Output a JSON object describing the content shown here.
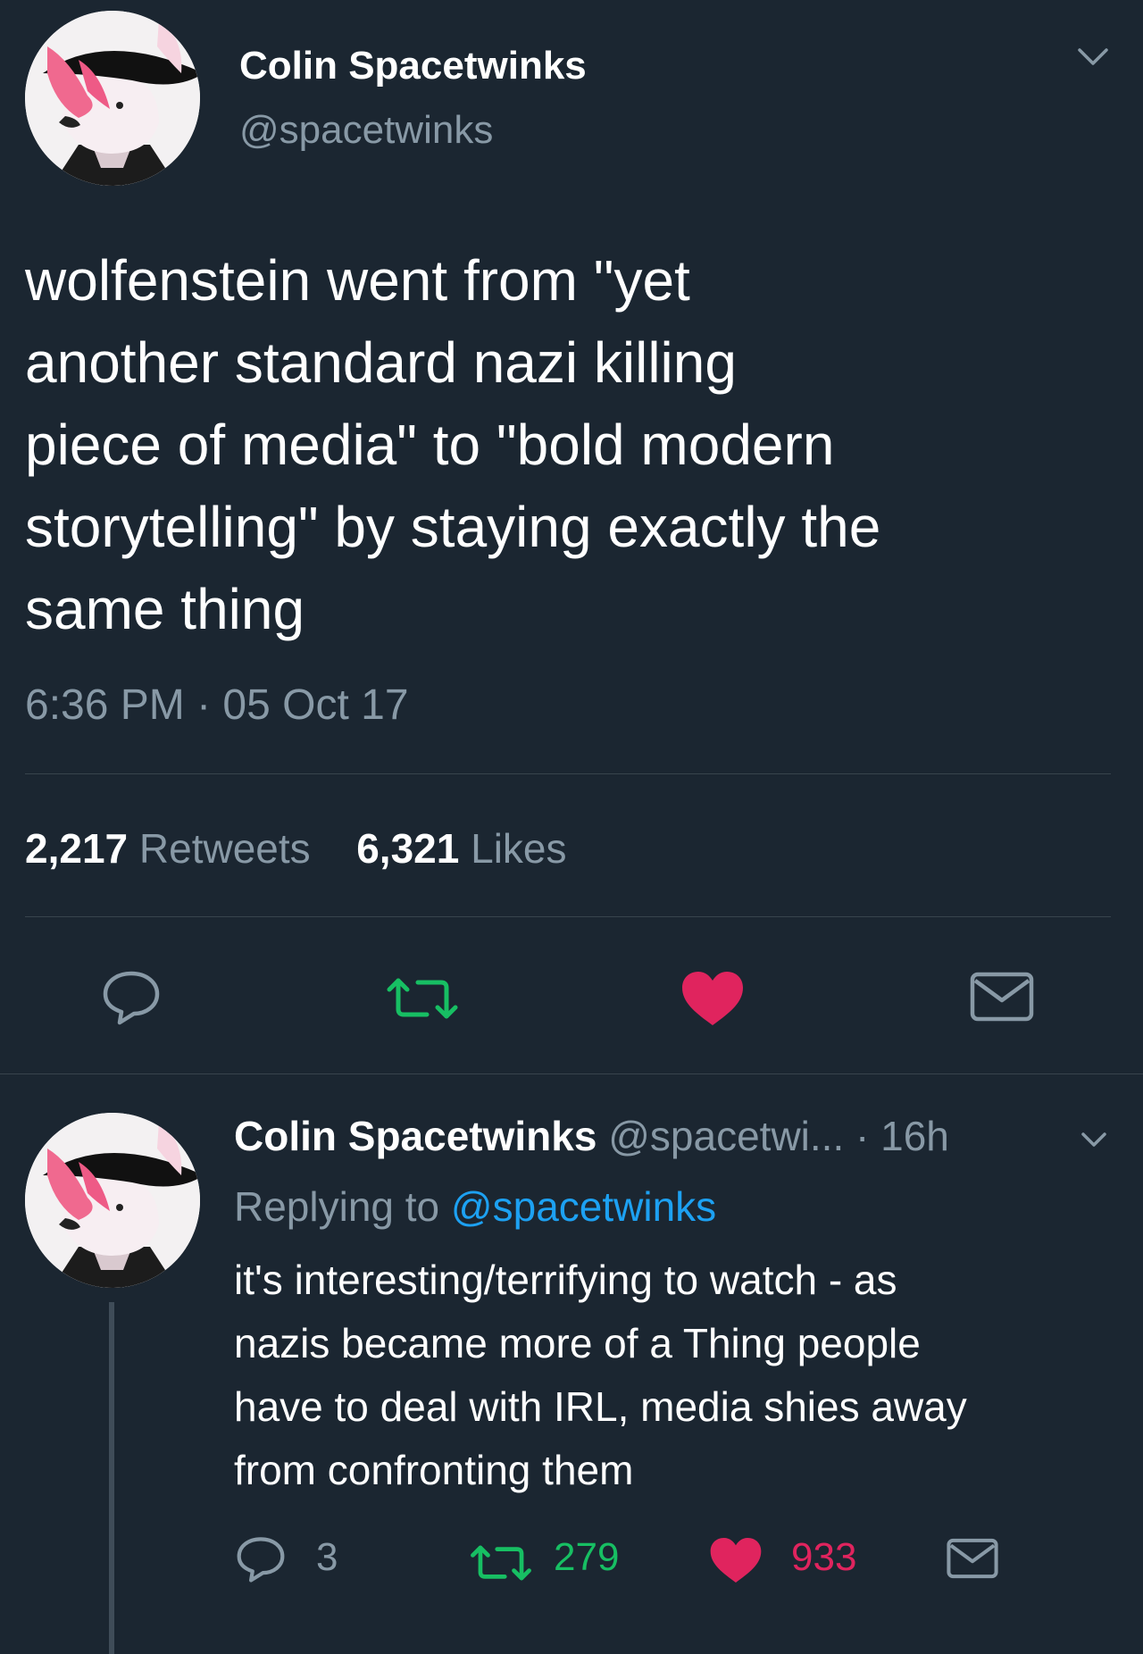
{
  "main_tweet": {
    "display_name": "Colin Spacetwinks",
    "handle": "@spacetwinks",
    "text_lines": [
      "wolfenstein went from \"yet",
      "another standard nazi killing",
      "piece of media\" to \"bold modern",
      "storytelling\" by staying exactly the",
      "same thing"
    ],
    "timestamp": "6:36 PM · 05 Oct 17",
    "retweets_count": "2,217",
    "retweets_label": "Retweets",
    "likes_count": "6,321",
    "likes_label": "Likes",
    "liked": true
  },
  "reply_tweet": {
    "display_name": "Colin Spacetwinks",
    "handle": "@spacetwi...",
    "age": "· 16h",
    "replying_prefix": "Replying to",
    "replying_handle": "@spacetwinks",
    "text_lines": [
      "it's interesting/terrifying to watch - as",
      "nazis became more of a Thing people",
      "have to deal with IRL, media shies away",
      "from confronting them"
    ],
    "reply_count": "3",
    "retweet_count": "279",
    "like_count": "933",
    "liked": true
  },
  "icons": {
    "caret": "chevron-down-icon",
    "reply": "speech-bubble-icon",
    "retweet": "retweet-arrows-icon",
    "like": "heart-icon",
    "message": "envelope-icon"
  },
  "colors": {
    "background": "#1b2631",
    "muted_text": "#8899a6",
    "link": "#1da1f2",
    "retweet_green": "#17bf63",
    "like_red": "#e0245e",
    "divider": "#38444d"
  }
}
